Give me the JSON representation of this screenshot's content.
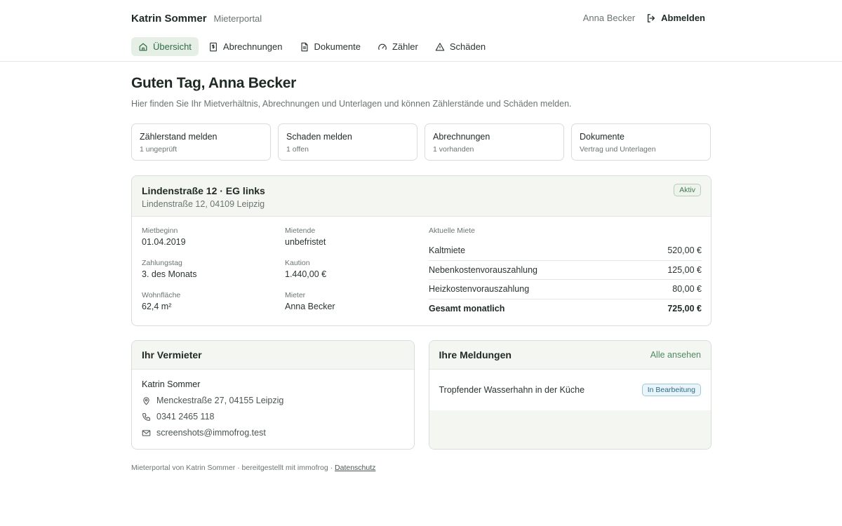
{
  "header": {
    "brand_name": "Katrin Sommer",
    "brand_sub": "Mieterportal",
    "user_name": "Anna Becker",
    "logout_label": "Abmelden"
  },
  "nav": {
    "items": [
      {
        "label": "Übersicht",
        "icon": "home-icon",
        "active": true
      },
      {
        "label": "Abrechnungen",
        "icon": "receipt-icon"
      },
      {
        "label": "Dokumente",
        "icon": "document-icon"
      },
      {
        "label": "Zähler",
        "icon": "gauge-icon"
      },
      {
        "label": "Schäden",
        "icon": "warning-icon"
      }
    ]
  },
  "main": {
    "greeting": "Guten Tag, Anna Becker",
    "intro": "Hier finden Sie Ihr Mietverhältnis, Abrechnungen und Unterlagen und können Zählerstände und Schäden melden."
  },
  "quick_actions": [
    {
      "title": "Zählerstand melden",
      "sub": "1 ungeprüft"
    },
    {
      "title": "Schaden melden",
      "sub": "1 offen"
    },
    {
      "title": "Abrechnungen",
      "sub": "1 vorhanden"
    },
    {
      "title": "Dokumente",
      "sub": "Vertrag und Unterlagen"
    }
  ],
  "rental": {
    "title": "Lindenstraße 12 · EG links",
    "address": "Lindenstraße 12, 04109 Leipzig",
    "status": "Aktiv",
    "facts": {
      "start_label": "Mietbeginn",
      "start_value": "01.04.2019",
      "end_label": "Mietende",
      "end_value": "unbefristet",
      "payday_label": "Zahlungstag",
      "payday_value": "3. des Monats",
      "deposit_label": "Kaution",
      "deposit_value": "1.440,00 €",
      "area_label": "Wohnfläche",
      "area_value": "62,4 m²",
      "tenant_label": "Mieter",
      "tenant_value": "Anna Becker"
    },
    "rent_label": "Aktuelle Miete",
    "rent_rows": [
      {
        "label": "Kaltmiete",
        "value": "520,00 €"
      },
      {
        "label": "Nebenkostenvorauszahlung",
        "value": "125,00 €"
      },
      {
        "label": "Heizkostenvorauszahlung",
        "value": "80,00 €"
      }
    ],
    "total_label": "Gesamt monatlich",
    "total_value": "725,00 €"
  },
  "landlord": {
    "heading": "Ihr Vermieter",
    "name": "Katrin Sommer",
    "address": "Menckestraße 27, 04155 Leipzig",
    "phone": "0341 2465 118",
    "email": "screenshots@immofrog.test"
  },
  "reports": {
    "heading": "Ihre Meldungen",
    "view_all": "Alle ansehen",
    "items": [
      {
        "text": "Tropfender Wasserhahn in der Küche",
        "status": "In Bearbeitung"
      }
    ]
  },
  "footer": {
    "text": "Mieterportal von Katrin Sommer · bereitgestellt mit immofrog ·",
    "link": "Datenschutz"
  },
  "colors": {
    "accent": "#2f6b45",
    "active_nav_bg": "#e6efe6",
    "panel_bg": "#f4f6f1",
    "badge_progress": "#2b6b8a"
  }
}
